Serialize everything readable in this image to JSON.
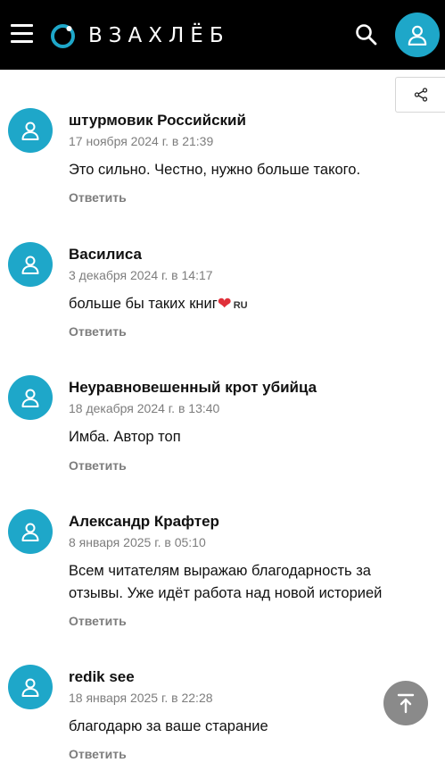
{
  "header": {
    "logo_text": "ВЗАХЛЁБ",
    "background": "#000000",
    "accent": "#1ea7c9",
    "icons": [
      "menu-icon",
      "search-icon",
      "user-icon"
    ]
  },
  "share": {
    "icon": "share-icon"
  },
  "comments": [
    {
      "author": "штурмовик Российский",
      "date": "17 ноября 2024 г. в 21:39",
      "text": "Это сильно. Честно, нужно больше такого.",
      "reply_label": "Ответить"
    },
    {
      "author": "Василиса",
      "date": "3 декабря 2024 г. в 14:17",
      "text": "больше бы таких книг",
      "emoji": "❤",
      "flag": "RU",
      "reply_label": "Ответить"
    },
    {
      "author": "Неуравновешенный крот убийца",
      "date": "18 декабря 2024 г. в 13:40",
      "text": "Имба. Автор топ",
      "reply_label": "Ответить"
    },
    {
      "author": "Александр Крафтер",
      "date": "8 января 2025 г. в 05:10",
      "text": "Всем читателям выражаю благодарность за отзывы. Уже идёт работа над новой историей",
      "reply_label": "Ответить"
    },
    {
      "author": "redik see",
      "date": "18 января 2025 г. в 22:28",
      "text": "благодарю за ваше старание",
      "reply_label": "Ответить"
    }
  ],
  "scroll_top": {
    "icon": "arrow-up-to-line-icon",
    "color": "#8a8a8a"
  }
}
